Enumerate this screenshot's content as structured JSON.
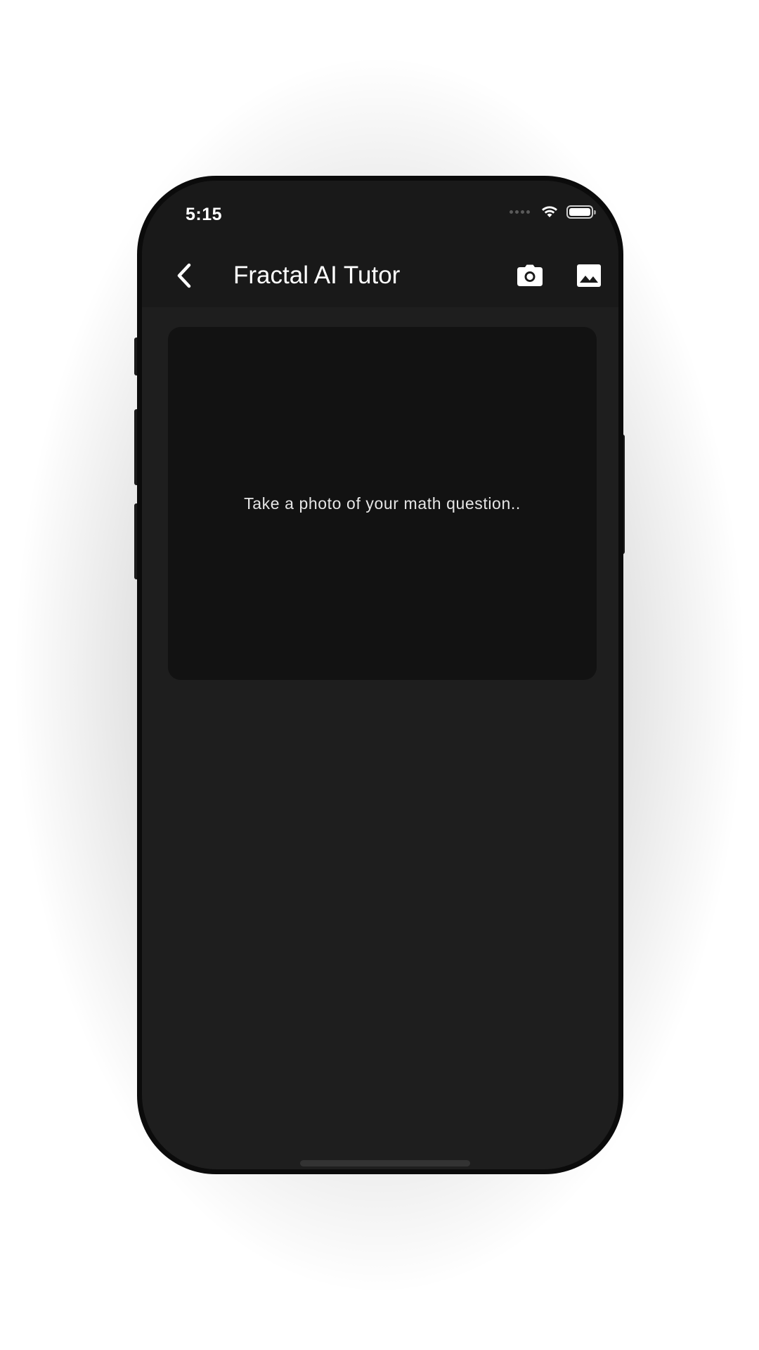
{
  "status_bar": {
    "time": "5:15",
    "icons": [
      "cellular-signal-icon",
      "wifi-icon",
      "battery-icon"
    ]
  },
  "nav_bar": {
    "back_icon": "chevron-left-icon",
    "title": "Fractal AI Tutor",
    "actions": [
      {
        "icon": "camera-icon"
      },
      {
        "icon": "image-gallery-icon"
      }
    ]
  },
  "capture_card": {
    "placeholder": "Take a photo of your math question.."
  },
  "colors": {
    "background": "#1e1e1e",
    "nav_background": "#191919",
    "card_background": "#121212",
    "text": "#ffffff"
  }
}
